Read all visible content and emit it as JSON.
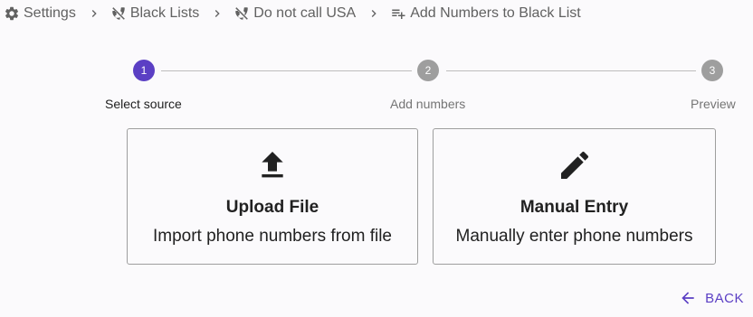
{
  "breadcrumb": {
    "items": [
      {
        "label": "Settings",
        "icon": "gear-icon"
      },
      {
        "label": "Black Lists",
        "icon": "phone-disabled-icon"
      },
      {
        "label": "Do not call USA",
        "icon": "phone-disabled-icon"
      },
      {
        "label": "Add Numbers to Black List",
        "icon": "playlist-add-icon"
      }
    ],
    "separator_icon": "chevron-right-icon"
  },
  "stepper": {
    "active_step": 1,
    "steps": [
      {
        "number": "1",
        "label": "Select source"
      },
      {
        "number": "2",
        "label": "Add numbers"
      },
      {
        "number": "3",
        "label": "Preview"
      }
    ]
  },
  "cards": [
    {
      "title": "Upload File",
      "description": "Import phone numbers from file",
      "icon": "upload-icon"
    },
    {
      "title": "Manual Entry",
      "description": "Manually enter phone numbers",
      "icon": "pencil-icon"
    }
  ],
  "back": {
    "label": "BACK",
    "icon": "arrow-left-icon"
  },
  "colors": {
    "accent": "#5b3fc4",
    "step_inactive": "#9e9e9e",
    "text_muted": "#616161"
  }
}
